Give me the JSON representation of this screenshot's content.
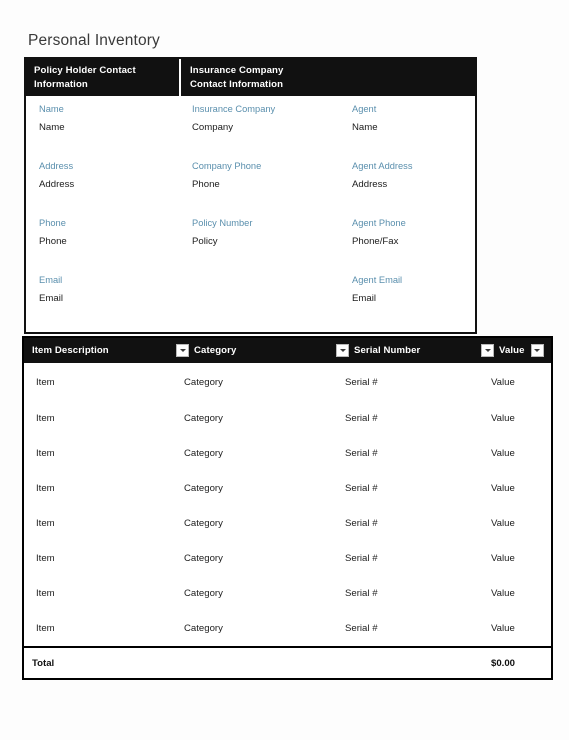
{
  "page": {
    "title": "Personal Inventory",
    "background_color": "#fdfdfd"
  },
  "colors": {
    "header_bar": "#111111",
    "label_blue": "#5a8fad",
    "body_text": "#1d1d1d"
  },
  "contact_panel": {
    "headers": {
      "left_line1": "Policy Holder Contact",
      "left_line2": "Information",
      "right_line1": "Insurance Company",
      "right_line2": "Contact Information"
    },
    "rows": [
      {
        "col1": {
          "label": "Name",
          "value": "Name"
        },
        "col2": {
          "label": "Insurance Company",
          "value": "Company"
        },
        "col3": {
          "label": "Agent",
          "value": "Name"
        }
      },
      {
        "col1": {
          "label": "Address",
          "value": "Address"
        },
        "col2": {
          "label": "Company Phone",
          "value": "Phone"
        },
        "col3": {
          "label": "Agent Address",
          "value": "Address"
        }
      },
      {
        "col1": {
          "label": "Phone",
          "value": "Phone"
        },
        "col2": {
          "label": "Policy Number",
          "value": "Policy"
        },
        "col3": {
          "label": "Agent Phone",
          "value": "Phone/Fax"
        }
      },
      {
        "col1": {
          "label": "Email",
          "value": "Email"
        },
        "col2": {
          "label": "",
          "value": ""
        },
        "col3": {
          "label": "Agent Email",
          "value": "Email"
        }
      }
    ]
  },
  "inventory_table": {
    "columns": [
      {
        "label": "Item Description",
        "filter": false
      },
      {
        "label": "Category",
        "filter": true
      },
      {
        "label": "Serial Number",
        "filter": true
      },
      {
        "label": "Value",
        "filter": true,
        "trailing_filter": true
      }
    ],
    "rows": [
      {
        "item": "Item",
        "category": "Category",
        "serial": "Serial #",
        "value": "Value"
      },
      {
        "item": "Item",
        "category": "Category",
        "serial": "Serial #",
        "value": "Value"
      },
      {
        "item": "Item",
        "category": "Category",
        "serial": "Serial #",
        "value": "Value"
      },
      {
        "item": "Item",
        "category": "Category",
        "serial": "Serial #",
        "value": "Value"
      },
      {
        "item": "Item",
        "category": "Category",
        "serial": "Serial #",
        "value": "Value"
      },
      {
        "item": "Item",
        "category": "Category",
        "serial": "Serial #",
        "value": "Value"
      },
      {
        "item": "Item",
        "category": "Category",
        "serial": "Serial #",
        "value": "Value"
      },
      {
        "item": "Item",
        "category": "Category",
        "serial": "Serial #",
        "value": "Value"
      }
    ],
    "total": {
      "label": "Total",
      "value": "$0.00"
    }
  }
}
